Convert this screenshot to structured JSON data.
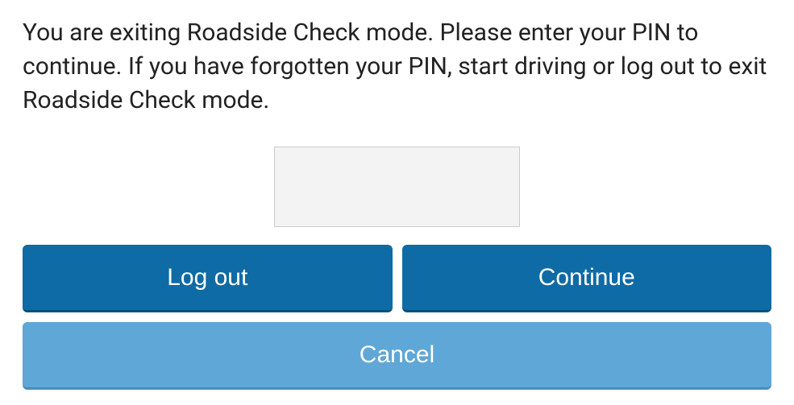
{
  "dialog": {
    "message": "You are exiting Roadside Check mode. Please enter your PIN to continue. If you have forgotten your PIN, start driving or log out to exit Roadside Check mode.",
    "pin_value": "",
    "buttons": {
      "logout": "Log out",
      "continue": "Continue",
      "cancel": "Cancel"
    },
    "colors": {
      "primary": "#0e6ba5",
      "secondary": "#5ea7d6"
    }
  }
}
